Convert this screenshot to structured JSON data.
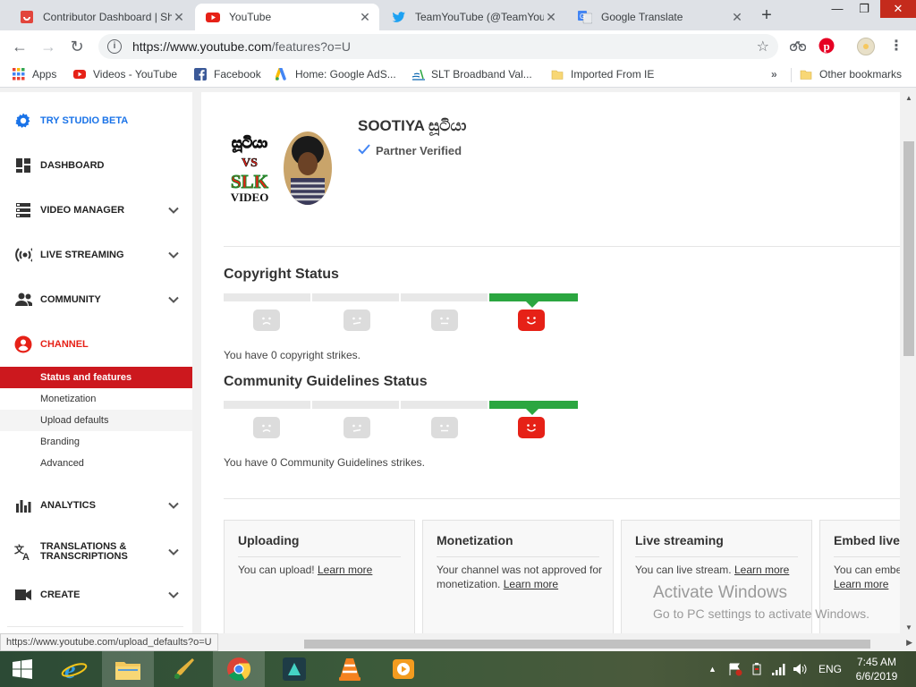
{
  "tabs": [
    {
      "title": "Contributor Dashboard | Sh",
      "icon": "contributor-icon",
      "active": false
    },
    {
      "title": "YouTube",
      "icon": "youtube-icon",
      "active": true
    },
    {
      "title": "TeamYouTube (@TeamYou",
      "icon": "twitter-icon",
      "active": false
    },
    {
      "title": "Google Translate",
      "icon": "translate-icon",
      "active": false
    }
  ],
  "tab_close": "✕",
  "url": {
    "host": "https://www.youtube.com",
    "path": "/features?o=U"
  },
  "bookmarks": [
    {
      "label": "Apps",
      "icon": "apps-grid-icon"
    },
    {
      "label": "Videos - YouTube",
      "icon": "youtube-icon"
    },
    {
      "label": "Facebook",
      "icon": "facebook-icon"
    },
    {
      "label": "Home: Google AdS...",
      "icon": "google-ads-icon"
    },
    {
      "label": "SLT Broadband Val...",
      "icon": "slt-icon"
    },
    {
      "label": "Imported From IE",
      "icon": "folder-icon"
    },
    {
      "label": "Other bookmarks",
      "icon": "folder-icon"
    }
  ],
  "sidebar": {
    "items": [
      {
        "label": "TRY STUDIO BETA",
        "icon": "gear-icon",
        "expandable": false
      },
      {
        "label": "DASHBOARD",
        "icon": "dashboard-icon",
        "expandable": false
      },
      {
        "label": "VIDEO MANAGER",
        "icon": "video-manager-icon",
        "expandable": true
      },
      {
        "label": "LIVE STREAMING",
        "icon": "live-streaming-icon",
        "expandable": true
      },
      {
        "label": "COMMUNITY",
        "icon": "community-icon",
        "expandable": true
      },
      {
        "label": "CHANNEL",
        "icon": "channel-icon",
        "expandable": false
      },
      {
        "label": "ANALYTICS",
        "icon": "analytics-icon",
        "expandable": true
      },
      {
        "label": "TRANSLATIONS & TRANSCRIPTIONS",
        "icon": "translate-icon",
        "expandable": true
      },
      {
        "label": "CREATE",
        "icon": "create-icon",
        "expandable": true
      }
    ],
    "channel_subitems": [
      "Status and features",
      "Monetization",
      "Upload defaults",
      "Branding",
      "Advanced"
    ],
    "active_subitem": "Status and features"
  },
  "channel": {
    "name": "SOOTIYA සූටියා",
    "verified_label": "Partner Verified",
    "logo_text": {
      "line1": "සූටියා",
      "line2": "VS",
      "line3": "SLK",
      "line4": "VIDEO"
    }
  },
  "copyright": {
    "title": "Copyright Status",
    "strikes_text": "You have 0 copyright strikes.",
    "strikes": 0
  },
  "community": {
    "title": "Community Guidelines Status",
    "strikes_text": "You have 0 Community Guidelines strikes.",
    "strikes": 0
  },
  "feature_cards": [
    {
      "title": "Uploading",
      "text": "You can upload!",
      "link": "Learn more"
    },
    {
      "title": "Monetization",
      "text": "Your channel was not approved for monetization.",
      "link": "Learn more"
    },
    {
      "title": "Live streaming",
      "text": "You can live stream.",
      "link": "Learn more"
    },
    {
      "title": "Embed live s",
      "text": "You can embe",
      "link": "Learn more"
    }
  ],
  "watermark": {
    "line1": "Activate Windows",
    "line2": "Go to PC settings to activate Windows."
  },
  "status_url": "https://www.youtube.com/upload_defaults?o=U",
  "taskbar": {
    "apps": [
      "start-icon",
      "ie-icon",
      "file-explorer-icon",
      "paint-icon",
      "chrome-icon",
      "filmora-icon",
      "vlc-icon",
      "video-player-icon"
    ],
    "active_app": "chrome-icon",
    "language": "ENG",
    "time": "7:45 AM",
    "date": "6/6/2019"
  },
  "colors": {
    "brand_red": "#e62117",
    "active_red": "#cc181e",
    "strike_green": "#2ba640",
    "link_blue": "#1a73e8"
  }
}
